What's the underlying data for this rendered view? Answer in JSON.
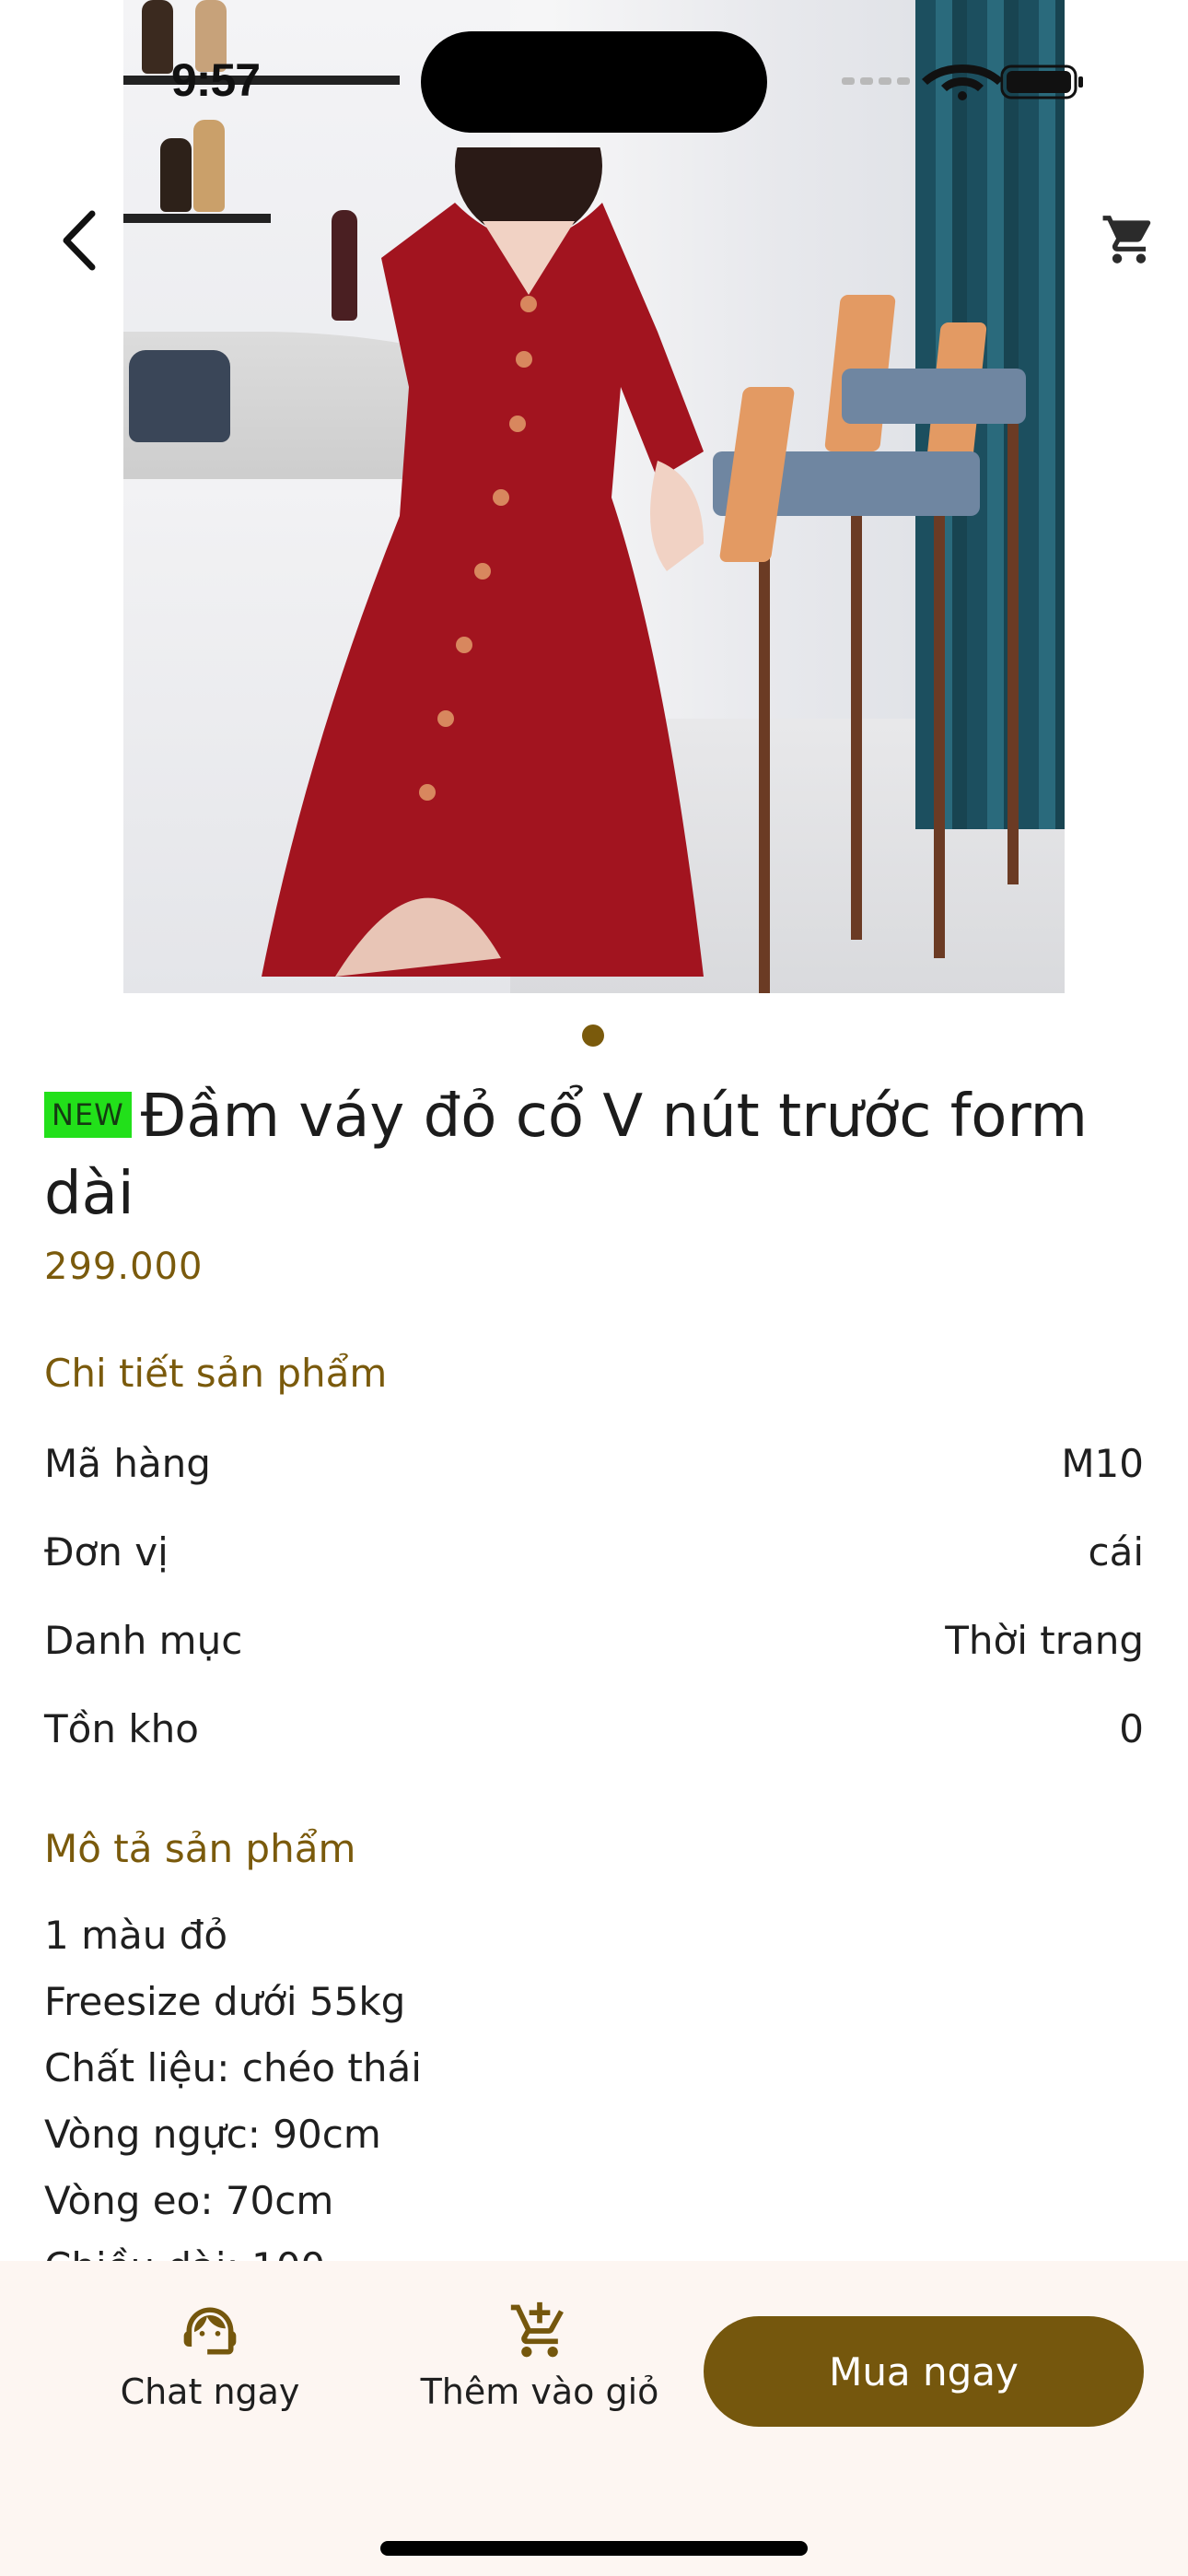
{
  "status_bar": {
    "time": "9:57"
  },
  "product": {
    "badge": "NEW",
    "name": "Đầm váy đỏ cổ V nút trước form dài",
    "price": "299.000",
    "image_pages": 1,
    "current_page": 1
  },
  "details": {
    "heading": "Chi tiết sản phẩm",
    "rows": [
      {
        "label": "Mã hàng",
        "value": "M10"
      },
      {
        "label": "Đơn vị",
        "value": "cái"
      },
      {
        "label": "Danh mục",
        "value": "Thời trang"
      },
      {
        "label": "Tồn kho",
        "value": "0"
      }
    ]
  },
  "description": {
    "heading": "Mô tả sản phẩm",
    "lines": [
      "1 màu đỏ",
      "Freesize dưới 55kg",
      "Chất liệu: chéo thái",
      "Vòng ngực: 90cm",
      "Vòng eo: 70cm",
      "Chiều dài: 100"
    ]
  },
  "bottom_bar": {
    "chat_label": "Chat ngay",
    "add_to_cart_label": "Thêm vào giỏ",
    "buy_label": "Mua ngay"
  },
  "icons": {
    "back": "chevron-left-icon",
    "cart": "cart-icon",
    "chat": "support-agent-icon",
    "add_to_cart": "cart-plus-icon"
  },
  "colors": {
    "accent": "#75570d",
    "badge": "#22e01a",
    "bottom_bar_bg": "#fdf6f2"
  }
}
